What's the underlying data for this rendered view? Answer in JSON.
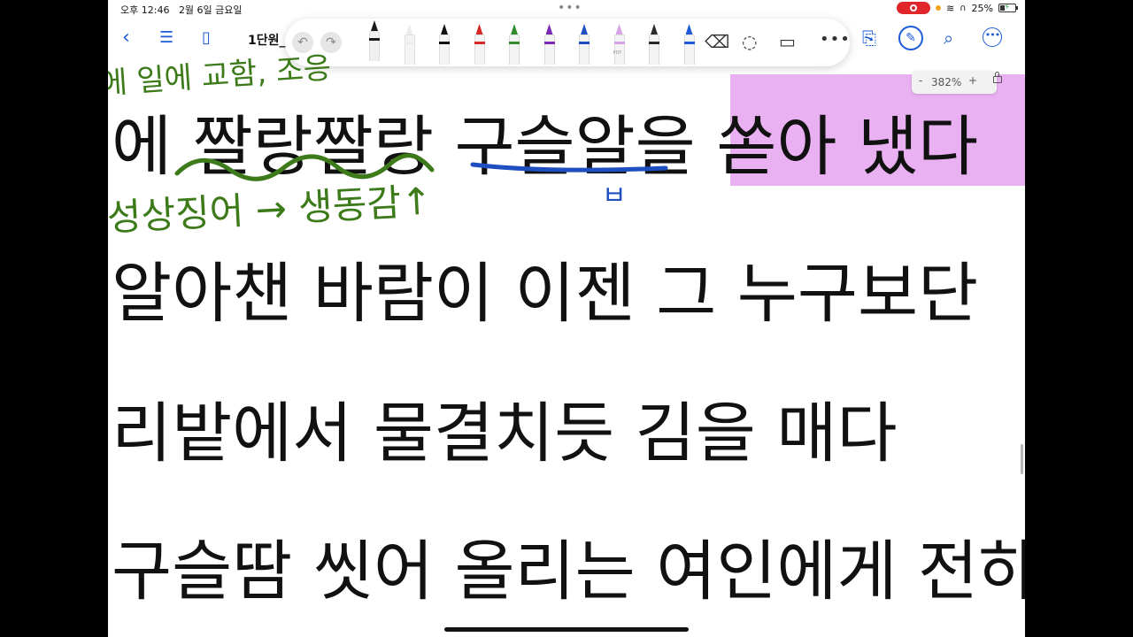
{
  "status_bar": {
    "time": "오후 12:46",
    "date": "2월 6일 금요일",
    "battery": "25%"
  },
  "nav": {
    "doc_title": "1단원_"
  },
  "toolbar": {
    "pen_colors": [
      "#1a1a1a",
      "#ececec",
      "#111111",
      "#d62828",
      "#2e8b2e",
      "#7b2ab8",
      "#1e4fc0",
      "#d6a3e6",
      "#2a2a2a",
      "#1e5bd6"
    ],
    "highlighter_label": "PDF"
  },
  "zoom": {
    "minus": "-",
    "value": "382%",
    "plus": "+"
  },
  "document": {
    "lines": [
      "에 짤랑짤랑 구슬알을 쏟아 냈다",
      "알아챈 바람이 이젠 그 누구보단",
      "리밭에서 물결치듯 김을 매다",
      "구슬땀 씻어 올리는 여인에게 전하"
    ],
    "highlight_color": "#eab1f2"
  },
  "annotations": {
    "top_note": "에 일에 교함, 조응",
    "note_mid": "음성상징어 →  생동감↑",
    "blue_mark": "ㅂ",
    "green_ink": "#3c7a1a",
    "blue_ink": "#1e4fc0"
  }
}
